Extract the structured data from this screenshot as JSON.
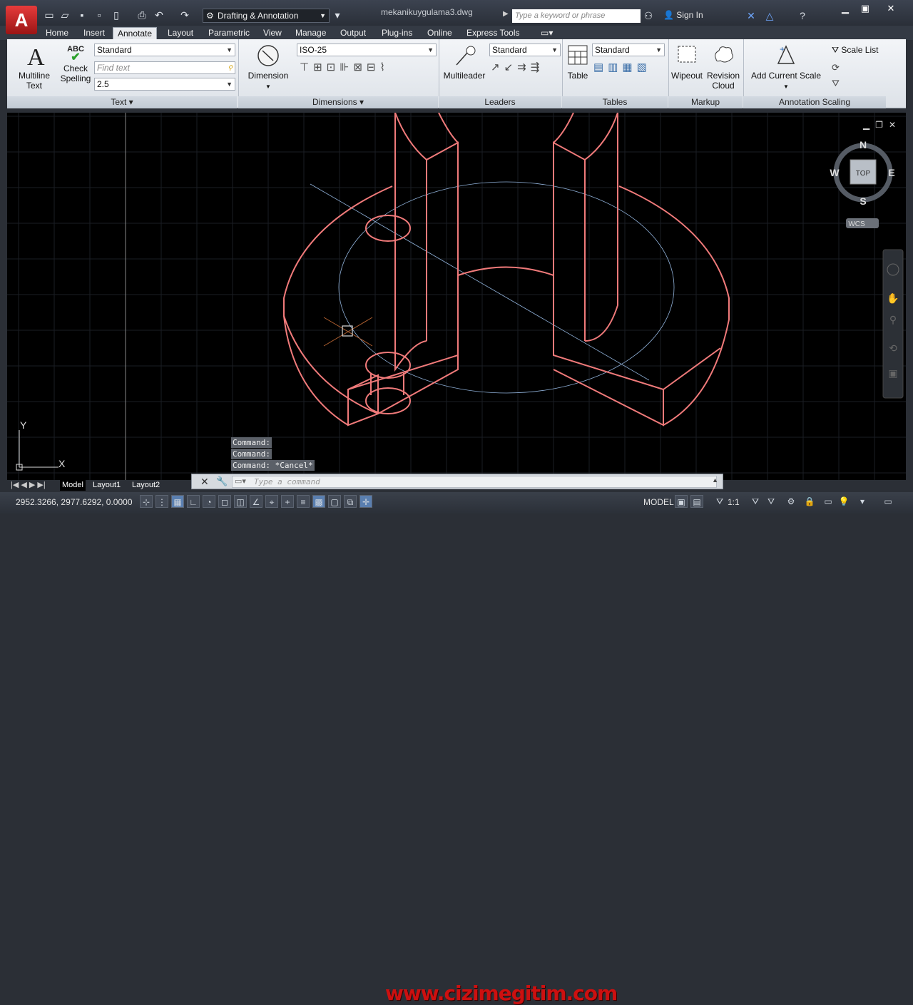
{
  "title_bar": {
    "app_letter": "A",
    "workspace": "Drafting & Annotation",
    "document": "mekanikuygulama3.dwg",
    "search_placeholder": "Type a keyword or phrase",
    "sign_in": "Sign In"
  },
  "ribbon_tabs": [
    "Home",
    "Insert",
    "Annotate",
    "Layout",
    "Parametric",
    "View",
    "Manage",
    "Output",
    "Plug-ins",
    "Online",
    "Express Tools"
  ],
  "active_tab": "Annotate",
  "panels": {
    "text": {
      "title": "Text",
      "multiline_text": "Multiline Text",
      "multiline_text_line1": "Multiline",
      "multiline_text_line2": "Text",
      "check_spelling_line1": "Check",
      "check_spelling_line2": "Spelling",
      "abc": "ABC",
      "style": "Standard",
      "find_placeholder": "Find text",
      "height": "2.5"
    },
    "dimensions": {
      "title": "Dimensions",
      "dimension": "Dimension",
      "style": "ISO-25"
    },
    "leaders": {
      "title": "Leaders",
      "multileader": "Multileader",
      "style": "Standard"
    },
    "tables": {
      "title": "Tables",
      "table": "Table",
      "style": "Standard"
    },
    "markup": {
      "title": "Markup",
      "wipeout": "Wipeout",
      "revision_cloud_line1": "Revision",
      "revision_cloud_line2": "Cloud"
    },
    "annotation_scaling": {
      "title": "Annotation Scaling",
      "scale_list": "Scale List",
      "add_current_scale": "Add Current Scale"
    }
  },
  "viewcube": {
    "n": "N",
    "s": "S",
    "e": "E",
    "w": "W",
    "top": "TOP",
    "wcs": "WCS"
  },
  "ucs": {
    "x": "X",
    "y": "Y"
  },
  "command_history": [
    "Command:",
    "Command:",
    "Command: *Cancel*"
  ],
  "command_placeholder": "Type a command",
  "layout_tabs": [
    "Model",
    "Layout1",
    "Layout2"
  ],
  "active_layout": "Model",
  "status": {
    "coordinates": "2952.3266, 2977.6292, 0.0000",
    "space": "MODEL",
    "scale": "1:1"
  },
  "watermark": "www.cizimegitim.com",
  "colors": {
    "geometry": "#f07a7a",
    "centerline": "#8fb0d8",
    "grid": "#1a1d22",
    "drawing_bg": "#000000"
  }
}
